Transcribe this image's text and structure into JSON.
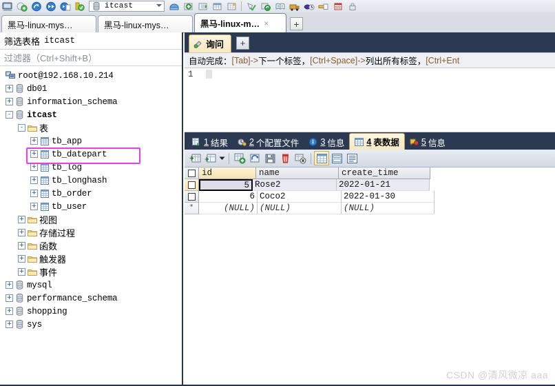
{
  "toolbar": {
    "db_selector": {
      "value": "itcast",
      "icon": "database-icon",
      "caret": "chevron-down-icon"
    },
    "icons": [
      "connection-icon",
      "new-connection-icon",
      "refresh-icon",
      "forward-refresh-icon",
      "copy-connection-icon",
      "sql-format-icon"
    ],
    "icons_right": [
      "export-icon",
      "import-icon",
      "table-export-icon",
      "table-data-icon",
      "grid-icon",
      "check-sql-icon",
      "sync-icon",
      "schema-designer-icon",
      "data-transfer-icon",
      "scheduler-icon",
      "notes-icon",
      "calendar-icon",
      "lock-icon"
    ]
  },
  "window_tabs": [
    {
      "label": "黑马-linux-mys…",
      "active": false,
      "closable": false
    },
    {
      "label": "黑马-linux-mys…",
      "active": false,
      "closable": false
    },
    {
      "label": "黑马-linux-m…",
      "active": true,
      "closable": true,
      "close_glyph": "×"
    }
  ],
  "new_tab_button": {
    "label": "+",
    "name": "new-connection-tab"
  },
  "sidebar": {
    "filter_label": "筛选表格",
    "filter_value": "itcast",
    "filter_placeholder": "过滤器（Ctrl+Shift+B）",
    "tree": [
      {
        "label": "root@192.168.10.214",
        "icon": "server-icon",
        "indent": 0,
        "expander": "",
        "bold": false,
        "cjk": false
      },
      {
        "label": "db01",
        "icon": "database-icon",
        "indent": 1,
        "expander": "+",
        "bold": false,
        "cjk": false
      },
      {
        "label": "information_schema",
        "icon": "database-icon",
        "indent": 1,
        "expander": "+",
        "bold": false,
        "cjk": false
      },
      {
        "label": "itcast",
        "icon": "database-icon",
        "indent": 1,
        "expander": "-",
        "bold": true,
        "cjk": false
      },
      {
        "label": "表",
        "icon": "folder-icon",
        "indent": 2,
        "expander": "-",
        "bold": false,
        "cjk": true
      },
      {
        "label": "tb_app",
        "icon": "table-icon",
        "indent": 3,
        "expander": "+",
        "bold": false,
        "cjk": false
      },
      {
        "label": "tb_datepart",
        "icon": "table-icon",
        "indent": 3,
        "expander": "+",
        "bold": false,
        "cjk": false,
        "highlight": true
      },
      {
        "label": "tb_log",
        "icon": "table-icon",
        "indent": 3,
        "expander": "+",
        "bold": false,
        "cjk": false
      },
      {
        "label": "tb_longhash",
        "icon": "table-icon",
        "indent": 3,
        "expander": "+",
        "bold": false,
        "cjk": false
      },
      {
        "label": "tb_order",
        "icon": "table-icon",
        "indent": 3,
        "expander": "+",
        "bold": false,
        "cjk": false
      },
      {
        "label": "tb_user",
        "icon": "table-icon",
        "indent": 3,
        "expander": "+",
        "bold": false,
        "cjk": false
      },
      {
        "label": "视图",
        "icon": "folder-icon",
        "indent": 2,
        "expander": "+",
        "bold": false,
        "cjk": true
      },
      {
        "label": "存储过程",
        "icon": "folder-icon",
        "indent": 2,
        "expander": "+",
        "bold": false,
        "cjk": true
      },
      {
        "label": "函数",
        "icon": "folder-icon",
        "indent": 2,
        "expander": "+",
        "bold": false,
        "cjk": true
      },
      {
        "label": "触发器",
        "icon": "folder-icon",
        "indent": 2,
        "expander": "+",
        "bold": false,
        "cjk": true
      },
      {
        "label": "事件",
        "icon": "folder-icon",
        "indent": 2,
        "expander": "+",
        "bold": false,
        "cjk": true
      },
      {
        "label": "mysql",
        "icon": "database-icon",
        "indent": 1,
        "expander": "+",
        "bold": false,
        "cjk": false
      },
      {
        "label": "performance_schema",
        "icon": "database-icon",
        "indent": 1,
        "expander": "+",
        "bold": false,
        "cjk": false
      },
      {
        "label": "shopping",
        "icon": "database-icon",
        "indent": 1,
        "expander": "+",
        "bold": false,
        "cjk": false
      },
      {
        "label": "sys",
        "icon": "database-icon",
        "indent": 1,
        "expander": "+",
        "bold": false,
        "cjk": false
      }
    ],
    "highlight_color": "#ef3bef"
  },
  "query_panel": {
    "tab_label": "询问",
    "tab_icon": "query-icon",
    "add_tab": "+",
    "hint_prefix": "自动完成：",
    "hint_parts": [
      {
        "text": "[Tab]-> ",
        "key": true
      },
      {
        "text": "下一个标签，",
        "key": false
      },
      {
        "text": "[Ctrl+Space]-> ",
        "key": true
      },
      {
        "text": "列出所有标签，",
        "key": false
      },
      {
        "text": "[Ctrl+Ent",
        "key": true
      }
    ],
    "line_number": "1",
    "editor_text": ""
  },
  "result_tabs": [
    {
      "num": "1",
      "label": "结果",
      "icon": "result-grid-icon",
      "active": false
    },
    {
      "num": "2",
      "label": "个配置文件",
      "icon": "profile-icon",
      "active": false
    },
    {
      "num": "3",
      "label": "信息",
      "icon": "info-icon",
      "active": false
    },
    {
      "num": "4",
      "label": "表数据",
      "icon": "table-data-icon",
      "active": true
    },
    {
      "num": "5",
      "label": "信息",
      "icon": "message-icon",
      "active": false
    }
  ],
  "grid_toolbar": {
    "buttons": [
      {
        "name": "refresh-data-icon",
        "selected": false
      },
      {
        "name": "filter-data-icon",
        "selected": false
      },
      {
        "name": "dropdown-caret-icon",
        "selected": false
      },
      {
        "name": "insert-row-icon",
        "selected": false
      },
      {
        "name": "update-row-icon",
        "selected": false
      },
      {
        "name": "save-icon",
        "selected": false
      },
      {
        "name": "delete-row-icon",
        "selected": false
      },
      {
        "name": "cancel-edit-icon",
        "selected": false
      },
      {
        "name": "grid-view-icon",
        "selected": true
      },
      {
        "name": "form-view-icon",
        "selected": false
      },
      {
        "name": "text-view-icon",
        "selected": false
      }
    ]
  },
  "data_grid": {
    "columns": [
      "id",
      "name",
      "create_time"
    ],
    "key_column": "id",
    "rows": [
      {
        "selector": "checkbox",
        "current": true,
        "cells": [
          "5",
          "Rose2",
          "2022-01-21"
        ]
      },
      {
        "selector": "checkbox",
        "current": false,
        "cells": [
          "6",
          "Coco2",
          "2022-01-30"
        ]
      },
      {
        "selector": "star",
        "current": false,
        "cells": [
          "(NULL)",
          "(NULL)",
          "(NULL)"
        ]
      }
    ],
    "active_cell": {
      "row": 0,
      "col": 0
    }
  },
  "watermark": "CSDN @清风微凉 aaa"
}
